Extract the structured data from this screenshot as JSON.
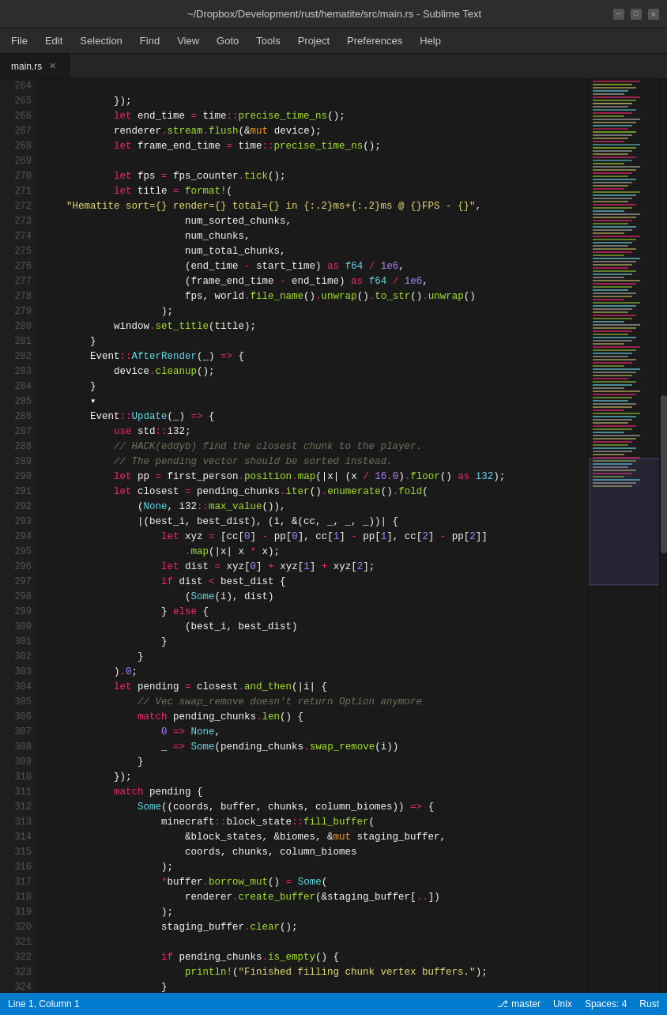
{
  "titleBar": {
    "title": "~/Dropbox/Development/rust/hematite/src/main.rs - Sublime Text",
    "minimizeLabel": "—",
    "maximizeLabel": "□",
    "closeLabel": "✕"
  },
  "menuBar": {
    "items": [
      "File",
      "Edit",
      "Selection",
      "Find",
      "View",
      "Goto",
      "Tools",
      "Project",
      "Preferences",
      "Help"
    ]
  },
  "tabs": [
    {
      "label": "main.rs",
      "active": true
    }
  ],
  "statusBar": {
    "position": "Line 1, Column 1",
    "branch": "master",
    "lineEnding": "Unix",
    "spaces": "Spaces: 4",
    "language": "Rust"
  }
}
